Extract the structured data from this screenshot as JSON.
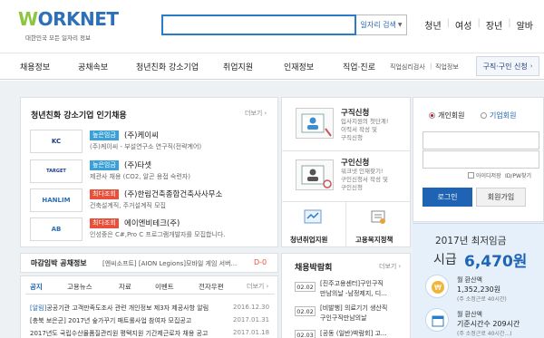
{
  "header": {
    "logo_text_w": "W",
    "logo_text_rest": "ORKNET",
    "tagline": "대한민국 모든 일자리 정보",
    "search_button": "일자리 검색",
    "quick_links": [
      "청년",
      "여성",
      "장년",
      "알바"
    ]
  },
  "nav": {
    "items": [
      "채용정보",
      "공채속보",
      "청년친화 강소기업",
      "취업지원",
      "인재정보",
      "직업·진로"
    ],
    "small_links": [
      "직업심리검사",
      "직업정보"
    ],
    "apply_button": "구직·구인 신청"
  },
  "companies": {
    "title": "청년친화 강소기업 인기채용",
    "more": "더보기",
    "rows": [
      {
        "logo": "KC",
        "badge": "높은임금",
        "badge_color": "#3aa0d8",
        "name": "(주)케이씨",
        "desc": "(주)케이씨 - 부설연구소 연구직(전략계어)"
      },
      {
        "logo": "TARGET",
        "badge": "높은임금",
        "badge_color": "#3aa0d8",
        "name": "(주)타셋",
        "desc": "제관사 채용 (CO2, 알곤 용접 숙련자)"
      },
      {
        "logo": "HANLIM",
        "badge": "최다조회",
        "badge_color": "#e8503a",
        "name": "(주)한림건축종합건축사사무소",
        "desc": "건축설계직, 주거설계직 모집"
      },
      {
        "logo": "AB",
        "badge": "최다조회",
        "badge_color": "#e8503a",
        "name": "에이엔비테크(주)",
        "desc": "인성중은 C#,Pro C 프로그램개발자를 모집합니다."
      }
    ]
  },
  "deadline": {
    "title": "마감임박 공채정보",
    "text": "[엔씨소프트] [AION Legions]모바일 게임 서버...",
    "dday": "D-0"
  },
  "notices": {
    "tabs": [
      "공지",
      "고용뉴스",
      "자료",
      "이벤트",
      "전자우편"
    ],
    "more": "더보기",
    "items": [
      {
        "tag": "[알림]",
        "text": "공공기관 고객만족도조사 관련 개인정보 제3자 제공사항 알림",
        "date": "2016.12.30"
      },
      {
        "tag": "",
        "text": "[충북 보은군] 2017년 숲가꾸기 패트롤사업 참여자 모집공고",
        "date": "2017.01.31"
      },
      {
        "tag": "",
        "text": "2017년도 국립수산물품질관리원 평택지원 기간제근로자 채용 공고",
        "date": "2017.01.18"
      }
    ]
  },
  "services": {
    "jobseek": {
      "title": "구직신청",
      "desc": [
        "입사지원의 첫단계!",
        "이력서 작성 및",
        "구직신청"
      ]
    },
    "hire": {
      "title": "구인신청",
      "desc": [
        "워크넷 인재찾기!",
        "구인신청서 작성 및",
        "구인신청"
      ]
    },
    "youth": "청년취업지원",
    "welfare": "고용복지정책"
  },
  "fair": {
    "title": "채용박람회",
    "more": "더보기",
    "items": [
      {
        "date": "02.02",
        "lines": [
          "[진주고용센터]구인구직",
          "만남의날 -남정제지, 디..."
        ]
      },
      {
        "date": "02.02",
        "lines": [
          "[비발행] 의료기기 생산직",
          "구인구직만남의날"
        ]
      },
      {
        "date": "02.03",
        "lines": [
          "[공동 (일반)박람회] 고...",
          ""
        ]
      }
    ]
  },
  "login": {
    "personal": "개인회원",
    "corporate": "기업회원",
    "save_id": "아이디저장",
    "find": "ID/PW찾기",
    "login_button": "로그인",
    "join_button": "회원가입"
  },
  "wage": {
    "title": "2017년 최저임금",
    "hourly_label": "시급",
    "hourly_value": "6,470원",
    "monthly_label": "월 환산액",
    "monthly_value": "1,352,230원",
    "monthly_note": "(주 소정근로 40시간)",
    "monthly2_label": "월 환산액",
    "monthly2_value": "기준시간수 209시간",
    "monthly2_note": "(주 소정근로 40시간...)"
  },
  "colors": {
    "brand_blue": "#1f64b4",
    "brand_green": "#8cc63e",
    "badge_blue": "#3aa0d8",
    "badge_red": "#e8503a"
  }
}
